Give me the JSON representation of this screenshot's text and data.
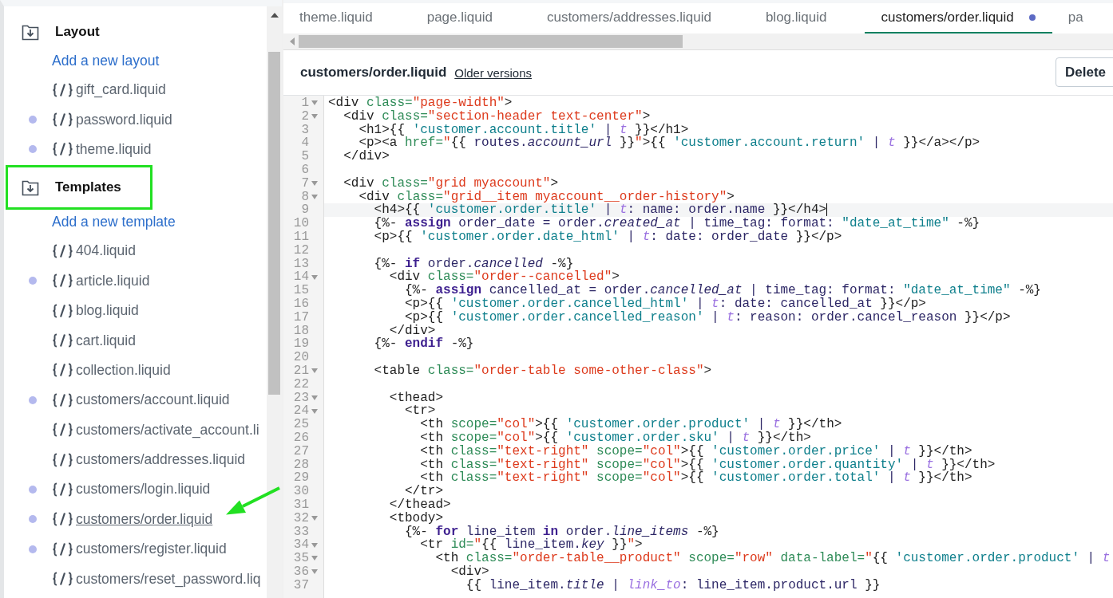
{
  "sidebar": {
    "sections": [
      {
        "title": "Layout",
        "highlighted": false,
        "add_link": "Add a new layout",
        "files": [
          {
            "name": "gift_card.liquid",
            "modified": false,
            "selected": false
          },
          {
            "name": "password.liquid",
            "modified": true,
            "selected": false
          },
          {
            "name": "theme.liquid",
            "modified": true,
            "selected": false
          }
        ]
      },
      {
        "title": "Templates",
        "highlighted": true,
        "add_link": "Add a new template",
        "files": [
          {
            "name": "404.liquid",
            "modified": false,
            "selected": false
          },
          {
            "name": "article.liquid",
            "modified": true,
            "selected": false
          },
          {
            "name": "blog.liquid",
            "modified": false,
            "selected": false
          },
          {
            "name": "cart.liquid",
            "modified": false,
            "selected": false
          },
          {
            "name": "collection.liquid",
            "modified": false,
            "selected": false
          },
          {
            "name": "customers/account.liquid",
            "modified": true,
            "selected": false
          },
          {
            "name": "customers/activate_account.li",
            "modified": false,
            "selected": false
          },
          {
            "name": "customers/addresses.liquid",
            "modified": false,
            "selected": false
          },
          {
            "name": "customers/login.liquid",
            "modified": true,
            "selected": false
          },
          {
            "name": "customers/order.liquid",
            "modified": true,
            "selected": true
          },
          {
            "name": "customers/register.liquid",
            "modified": true,
            "selected": false
          },
          {
            "name": "customers/reset_password.liq",
            "modified": false,
            "selected": false
          }
        ]
      }
    ]
  },
  "tabs": [
    {
      "label": "theme.liquid",
      "selected": false,
      "modified": false
    },
    {
      "label": "page.liquid",
      "selected": false,
      "modified": false
    },
    {
      "label": "customers/addresses.liquid",
      "selected": false,
      "modified": false
    },
    {
      "label": "blog.liquid",
      "selected": false,
      "modified": false
    },
    {
      "label": "customers/order.liquid",
      "selected": true,
      "modified": true
    },
    {
      "label": "pa",
      "selected": false,
      "modified": false
    }
  ],
  "editor": {
    "file_title": "customers/order.liquid",
    "older_versions_link": "Older versions",
    "delete_button": "Delete",
    "lines": [
      {
        "n": "1",
        "fold": true,
        "active": false,
        "tokens": [
          {
            "kind": "p",
            "s": "<div "
          },
          {
            "kind": "a",
            "s": "class="
          },
          {
            "kind": "s",
            "s": "\"page-width\""
          },
          {
            "kind": "p",
            "s": ">"
          }
        ]
      },
      {
        "n": "2",
        "fold": true,
        "active": false,
        "tokens": [
          {
            "kind": "p",
            "s": "  <div "
          },
          {
            "kind": "a",
            "s": "class="
          },
          {
            "kind": "s",
            "s": "\"section-header text-center\""
          },
          {
            "kind": "p",
            "s": ">"
          }
        ]
      },
      {
        "n": "3",
        "fold": false,
        "active": false,
        "tokens": [
          {
            "kind": "p",
            "s": "    <h1>{{ "
          },
          {
            "kind": "l",
            "s": "'customer.account.title'"
          },
          {
            "kind": "v",
            "s": " | "
          },
          {
            "kind": "f",
            "s": "t"
          },
          {
            "kind": "p",
            "s": " }}</h1>"
          }
        ]
      },
      {
        "n": "4",
        "fold": false,
        "active": false,
        "tokens": [
          {
            "kind": "p",
            "s": "    <p><a "
          },
          {
            "kind": "a",
            "s": "href="
          },
          {
            "kind": "s",
            "s": "\""
          },
          {
            "kind": "p",
            "s": "{{ "
          },
          {
            "kind": "v",
            "s": "routes."
          },
          {
            "kind": "i",
            "s": "account_url"
          },
          {
            "kind": "p",
            "s": " }}"
          },
          {
            "kind": "s",
            "s": "\""
          },
          {
            "kind": "p",
            "s": ">{{ "
          },
          {
            "kind": "l",
            "s": "'customer.account.return'"
          },
          {
            "kind": "v",
            "s": " | "
          },
          {
            "kind": "f",
            "s": "t"
          },
          {
            "kind": "p",
            "s": " }}</a></p>"
          }
        ]
      },
      {
        "n": "5",
        "fold": false,
        "active": false,
        "tokens": [
          {
            "kind": "p",
            "s": "  </div>"
          }
        ]
      },
      {
        "n": "6",
        "fold": false,
        "active": false
      },
      {
        "n": "7",
        "fold": true,
        "active": false,
        "tokens": [
          {
            "kind": "p",
            "s": "  <div "
          },
          {
            "kind": "a",
            "s": "class="
          },
          {
            "kind": "s",
            "s": "\"grid myaccount\""
          },
          {
            "kind": "p",
            "s": ">"
          }
        ]
      },
      {
        "n": "8",
        "fold": true,
        "active": false,
        "tokens": [
          {
            "kind": "p",
            "s": "    <div "
          },
          {
            "kind": "a",
            "s": "class="
          },
          {
            "kind": "s",
            "s": "\"grid__item myaccount__order-history\""
          },
          {
            "kind": "p",
            "s": ">"
          }
        ]
      },
      {
        "n": "9",
        "fold": false,
        "active": true,
        "tokens": [
          {
            "kind": "p",
            "s": "      <h4>{{ "
          },
          {
            "kind": "l",
            "s": "'customer.order.title'"
          },
          {
            "kind": "v",
            "s": " | "
          },
          {
            "kind": "f",
            "s": "t"
          },
          {
            "kind": "v",
            "s": ": name: order.name"
          },
          {
            "kind": "p",
            "s": " }}</h4>"
          }
        ]
      },
      {
        "n": "10",
        "fold": false,
        "active": false,
        "tokens": [
          {
            "kind": "p",
            "s": "      {%- "
          },
          {
            "kind": "k",
            "s": "assign"
          },
          {
            "kind": "v",
            "s": " order_date = order."
          },
          {
            "kind": "i",
            "s": "created_at"
          },
          {
            "kind": "v",
            "s": " | time_tag: format: "
          },
          {
            "kind": "l",
            "s": "\"date_at_time\""
          },
          {
            "kind": "p",
            "s": " -%}"
          }
        ]
      },
      {
        "n": "11",
        "fold": false,
        "active": false,
        "tokens": [
          {
            "kind": "p",
            "s": "      <p>{{ "
          },
          {
            "kind": "l",
            "s": "'customer.order.date_html'"
          },
          {
            "kind": "v",
            "s": " | "
          },
          {
            "kind": "f",
            "s": "t"
          },
          {
            "kind": "v",
            "s": ": date: order_date"
          },
          {
            "kind": "p",
            "s": " }}</p>"
          }
        ]
      },
      {
        "n": "12",
        "fold": false,
        "active": false
      },
      {
        "n": "13",
        "fold": false,
        "active": false,
        "tokens": [
          {
            "kind": "p",
            "s": "      {%- "
          },
          {
            "kind": "k",
            "s": "if"
          },
          {
            "kind": "v",
            "s": " order."
          },
          {
            "kind": "i",
            "s": "cancelled"
          },
          {
            "kind": "p",
            "s": " -%}"
          }
        ]
      },
      {
        "n": "14",
        "fold": true,
        "active": false,
        "tokens": [
          {
            "kind": "p",
            "s": "        <div "
          },
          {
            "kind": "a",
            "s": "class="
          },
          {
            "kind": "s",
            "s": "\"order--cancelled\""
          },
          {
            "kind": "p",
            "s": ">"
          }
        ]
      },
      {
        "n": "15",
        "fold": false,
        "active": false,
        "tokens": [
          {
            "kind": "p",
            "s": "          {%- "
          },
          {
            "kind": "k",
            "s": "assign"
          },
          {
            "kind": "v",
            "s": " cancelled_at = order."
          },
          {
            "kind": "i",
            "s": "cancelled_at"
          },
          {
            "kind": "v",
            "s": " | time_tag: format: "
          },
          {
            "kind": "l",
            "s": "\"date_at_time\""
          },
          {
            "kind": "p",
            "s": " -%}"
          }
        ]
      },
      {
        "n": "16",
        "fold": false,
        "active": false,
        "tokens": [
          {
            "kind": "p",
            "s": "          <p>{{ "
          },
          {
            "kind": "l",
            "s": "'customer.order.cancelled_html'"
          },
          {
            "kind": "v",
            "s": " | "
          },
          {
            "kind": "f",
            "s": "t"
          },
          {
            "kind": "v",
            "s": ": date: cancelled_at"
          },
          {
            "kind": "p",
            "s": " }}</p>"
          }
        ]
      },
      {
        "n": "17",
        "fold": false,
        "active": false,
        "tokens": [
          {
            "kind": "p",
            "s": "          <p>{{ "
          },
          {
            "kind": "l",
            "s": "'customer.order.cancelled_reason'"
          },
          {
            "kind": "v",
            "s": " | "
          },
          {
            "kind": "f",
            "s": "t"
          },
          {
            "kind": "v",
            "s": ": reason: order.cancel_reason"
          },
          {
            "kind": "p",
            "s": " }}</p>"
          }
        ]
      },
      {
        "n": "18",
        "fold": false,
        "active": false,
        "tokens": [
          {
            "kind": "p",
            "s": "        </div>"
          }
        ]
      },
      {
        "n": "19",
        "fold": false,
        "active": false,
        "tokens": [
          {
            "kind": "p",
            "s": "      {%- "
          },
          {
            "kind": "k",
            "s": "endif"
          },
          {
            "kind": "p",
            "s": " -%}"
          }
        ]
      },
      {
        "n": "20",
        "fold": false,
        "active": false
      },
      {
        "n": "21",
        "fold": true,
        "active": false,
        "tokens": [
          {
            "kind": "p",
            "s": "      <table "
          },
          {
            "kind": "a",
            "s": "class="
          },
          {
            "kind": "s",
            "s": "\"order-table some-other-class\""
          },
          {
            "kind": "p",
            "s": ">"
          }
        ]
      },
      {
        "n": "22",
        "fold": false,
        "active": false
      },
      {
        "n": "23",
        "fold": true,
        "active": false,
        "tokens": [
          {
            "kind": "p",
            "s": "        <thead>"
          }
        ]
      },
      {
        "n": "24",
        "fold": true,
        "active": false,
        "tokens": [
          {
            "kind": "p",
            "s": "          <tr>"
          }
        ]
      },
      {
        "n": "25",
        "fold": false,
        "active": false,
        "tokens": [
          {
            "kind": "p",
            "s": "            <th "
          },
          {
            "kind": "a",
            "s": "scope="
          },
          {
            "kind": "s",
            "s": "\"col\""
          },
          {
            "kind": "p",
            "s": ">{{ "
          },
          {
            "kind": "l",
            "s": "'customer.order.product'"
          },
          {
            "kind": "v",
            "s": " | "
          },
          {
            "kind": "f",
            "s": "t"
          },
          {
            "kind": "p",
            "s": " }}</th>"
          }
        ]
      },
      {
        "n": "26",
        "fold": false,
        "active": false,
        "tokens": [
          {
            "kind": "p",
            "s": "            <th "
          },
          {
            "kind": "a",
            "s": "scope="
          },
          {
            "kind": "s",
            "s": "\"col\""
          },
          {
            "kind": "p",
            "s": ">{{ "
          },
          {
            "kind": "l",
            "s": "'customer.order.sku'"
          },
          {
            "kind": "v",
            "s": " | "
          },
          {
            "kind": "f",
            "s": "t"
          },
          {
            "kind": "p",
            "s": " }}</th>"
          }
        ]
      },
      {
        "n": "27",
        "fold": false,
        "active": false,
        "tokens": [
          {
            "kind": "p",
            "s": "            <th "
          },
          {
            "kind": "a",
            "s": "class="
          },
          {
            "kind": "s",
            "s": "\"text-right\""
          },
          {
            "kind": "a",
            "s": " scope="
          },
          {
            "kind": "s",
            "s": "\"col\""
          },
          {
            "kind": "p",
            "s": ">{{ "
          },
          {
            "kind": "l",
            "s": "'customer.order.price'"
          },
          {
            "kind": "v",
            "s": " | "
          },
          {
            "kind": "f",
            "s": "t"
          },
          {
            "kind": "p",
            "s": " }}</th>"
          }
        ]
      },
      {
        "n": "28",
        "fold": false,
        "active": false,
        "tokens": [
          {
            "kind": "p",
            "s": "            <th "
          },
          {
            "kind": "a",
            "s": "class="
          },
          {
            "kind": "s",
            "s": "\"text-right\""
          },
          {
            "kind": "a",
            "s": " scope="
          },
          {
            "kind": "s",
            "s": "\"col\""
          },
          {
            "kind": "p",
            "s": ">{{ "
          },
          {
            "kind": "l",
            "s": "'customer.order.quantity'"
          },
          {
            "kind": "v",
            "s": " | "
          },
          {
            "kind": "f",
            "s": "t"
          },
          {
            "kind": "p",
            "s": " }}</th>"
          }
        ]
      },
      {
        "n": "29",
        "fold": false,
        "active": false,
        "tokens": [
          {
            "kind": "p",
            "s": "            <th "
          },
          {
            "kind": "a",
            "s": "class="
          },
          {
            "kind": "s",
            "s": "\"text-right\""
          },
          {
            "kind": "a",
            "s": " scope="
          },
          {
            "kind": "s",
            "s": "\"col\""
          },
          {
            "kind": "p",
            "s": ">{{ "
          },
          {
            "kind": "l",
            "s": "'customer.order.total'"
          },
          {
            "kind": "v",
            "s": " | "
          },
          {
            "kind": "f",
            "s": "t"
          },
          {
            "kind": "p",
            "s": " }}</th>"
          }
        ]
      },
      {
        "n": "30",
        "fold": false,
        "active": false,
        "tokens": [
          {
            "kind": "p",
            "s": "          </tr>"
          }
        ]
      },
      {
        "n": "31",
        "fold": false,
        "active": false,
        "tokens": [
          {
            "kind": "p",
            "s": "        </thead>"
          }
        ]
      },
      {
        "n": "32",
        "fold": true,
        "active": false,
        "tokens": [
          {
            "kind": "p",
            "s": "        <tbody>"
          }
        ]
      },
      {
        "n": "33",
        "fold": false,
        "active": false,
        "tokens": [
          {
            "kind": "p",
            "s": "          {%- "
          },
          {
            "kind": "k",
            "s": "for"
          },
          {
            "kind": "v",
            "s": " line_item "
          },
          {
            "kind": "k",
            "s": "in"
          },
          {
            "kind": "v",
            "s": " order."
          },
          {
            "kind": "i",
            "s": "line_items"
          },
          {
            "kind": "p",
            "s": " -%}"
          }
        ]
      },
      {
        "n": "34",
        "fold": true,
        "active": false,
        "tokens": [
          {
            "kind": "p",
            "s": "            <tr "
          },
          {
            "kind": "a",
            "s": "id="
          },
          {
            "kind": "s",
            "s": "\""
          },
          {
            "kind": "p",
            "s": "{{ "
          },
          {
            "kind": "v",
            "s": "line_item."
          },
          {
            "kind": "i",
            "s": "key"
          },
          {
            "kind": "p",
            "s": " }}"
          },
          {
            "kind": "s",
            "s": "\""
          },
          {
            "kind": "p",
            "s": ">"
          }
        ]
      },
      {
        "n": "35",
        "fold": true,
        "active": false,
        "tokens": [
          {
            "kind": "p",
            "s": "              <th "
          },
          {
            "kind": "a",
            "s": "class="
          },
          {
            "kind": "s",
            "s": "\"order-table__product\""
          },
          {
            "kind": "a",
            "s": " scope="
          },
          {
            "kind": "s",
            "s": "\"row\""
          },
          {
            "kind": "a",
            "s": " data-label="
          },
          {
            "kind": "s",
            "s": "\""
          },
          {
            "kind": "p",
            "s": "{{ "
          },
          {
            "kind": "l",
            "s": "'customer.order.product'"
          },
          {
            "kind": "v",
            "s": " | "
          },
          {
            "kind": "f",
            "s": "t"
          }
        ]
      },
      {
        "n": "36",
        "fold": true,
        "active": false,
        "tokens": [
          {
            "kind": "p",
            "s": "                <div>"
          }
        ]
      },
      {
        "n": "37",
        "fold": false,
        "active": false,
        "tokens": [
          {
            "kind": "p",
            "s": "                  {{ "
          },
          {
            "kind": "v",
            "s": "line_item."
          },
          {
            "kind": "i",
            "s": "title"
          },
          {
            "kind": "v",
            "s": " | "
          },
          {
            "kind": "f",
            "s": "link_to"
          },
          {
            "kind": "v",
            "s": ": line_item.product.url"
          },
          {
            "kind": "p",
            "s": " }}"
          }
        ]
      }
    ]
  }
}
